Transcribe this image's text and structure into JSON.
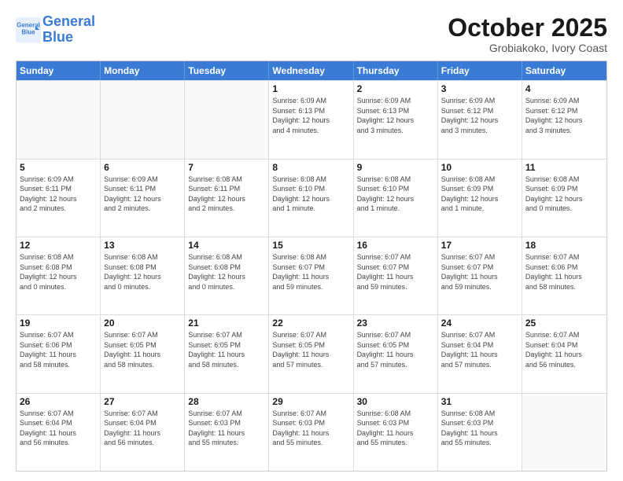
{
  "header": {
    "logo_line1": "General",
    "logo_line2": "Blue",
    "title": "October 2025",
    "subtitle": "Grobiakoko, Ivory Coast"
  },
  "days_of_week": [
    "Sunday",
    "Monday",
    "Tuesday",
    "Wednesday",
    "Thursday",
    "Friday",
    "Saturday"
  ],
  "weeks": [
    [
      {
        "day": "",
        "info": ""
      },
      {
        "day": "",
        "info": ""
      },
      {
        "day": "",
        "info": ""
      },
      {
        "day": "1",
        "info": "Sunrise: 6:09 AM\nSunset: 6:13 PM\nDaylight: 12 hours\nand 4 minutes."
      },
      {
        "day": "2",
        "info": "Sunrise: 6:09 AM\nSunset: 6:13 PM\nDaylight: 12 hours\nand 3 minutes."
      },
      {
        "day": "3",
        "info": "Sunrise: 6:09 AM\nSunset: 6:12 PM\nDaylight: 12 hours\nand 3 minutes."
      },
      {
        "day": "4",
        "info": "Sunrise: 6:09 AM\nSunset: 6:12 PM\nDaylight: 12 hours\nand 3 minutes."
      }
    ],
    [
      {
        "day": "5",
        "info": "Sunrise: 6:09 AM\nSunset: 6:11 PM\nDaylight: 12 hours\nand 2 minutes."
      },
      {
        "day": "6",
        "info": "Sunrise: 6:09 AM\nSunset: 6:11 PM\nDaylight: 12 hours\nand 2 minutes."
      },
      {
        "day": "7",
        "info": "Sunrise: 6:08 AM\nSunset: 6:11 PM\nDaylight: 12 hours\nand 2 minutes."
      },
      {
        "day": "8",
        "info": "Sunrise: 6:08 AM\nSunset: 6:10 PM\nDaylight: 12 hours\nand 1 minute."
      },
      {
        "day": "9",
        "info": "Sunrise: 6:08 AM\nSunset: 6:10 PM\nDaylight: 12 hours\nand 1 minute."
      },
      {
        "day": "10",
        "info": "Sunrise: 6:08 AM\nSunset: 6:09 PM\nDaylight: 12 hours\nand 1 minute."
      },
      {
        "day": "11",
        "info": "Sunrise: 6:08 AM\nSunset: 6:09 PM\nDaylight: 12 hours\nand 0 minutes."
      }
    ],
    [
      {
        "day": "12",
        "info": "Sunrise: 6:08 AM\nSunset: 6:08 PM\nDaylight: 12 hours\nand 0 minutes."
      },
      {
        "day": "13",
        "info": "Sunrise: 6:08 AM\nSunset: 6:08 PM\nDaylight: 12 hours\nand 0 minutes."
      },
      {
        "day": "14",
        "info": "Sunrise: 6:08 AM\nSunset: 6:08 PM\nDaylight: 12 hours\nand 0 minutes."
      },
      {
        "day": "15",
        "info": "Sunrise: 6:08 AM\nSunset: 6:07 PM\nDaylight: 11 hours\nand 59 minutes."
      },
      {
        "day": "16",
        "info": "Sunrise: 6:07 AM\nSunset: 6:07 PM\nDaylight: 11 hours\nand 59 minutes."
      },
      {
        "day": "17",
        "info": "Sunrise: 6:07 AM\nSunset: 6:07 PM\nDaylight: 11 hours\nand 59 minutes."
      },
      {
        "day": "18",
        "info": "Sunrise: 6:07 AM\nSunset: 6:06 PM\nDaylight: 11 hours\nand 58 minutes."
      }
    ],
    [
      {
        "day": "19",
        "info": "Sunrise: 6:07 AM\nSunset: 6:06 PM\nDaylight: 11 hours\nand 58 minutes."
      },
      {
        "day": "20",
        "info": "Sunrise: 6:07 AM\nSunset: 6:05 PM\nDaylight: 11 hours\nand 58 minutes."
      },
      {
        "day": "21",
        "info": "Sunrise: 6:07 AM\nSunset: 6:05 PM\nDaylight: 11 hours\nand 58 minutes."
      },
      {
        "day": "22",
        "info": "Sunrise: 6:07 AM\nSunset: 6:05 PM\nDaylight: 11 hours\nand 57 minutes."
      },
      {
        "day": "23",
        "info": "Sunrise: 6:07 AM\nSunset: 6:05 PM\nDaylight: 11 hours\nand 57 minutes."
      },
      {
        "day": "24",
        "info": "Sunrise: 6:07 AM\nSunset: 6:04 PM\nDaylight: 11 hours\nand 57 minutes."
      },
      {
        "day": "25",
        "info": "Sunrise: 6:07 AM\nSunset: 6:04 PM\nDaylight: 11 hours\nand 56 minutes."
      }
    ],
    [
      {
        "day": "26",
        "info": "Sunrise: 6:07 AM\nSunset: 6:04 PM\nDaylight: 11 hours\nand 56 minutes."
      },
      {
        "day": "27",
        "info": "Sunrise: 6:07 AM\nSunset: 6:04 PM\nDaylight: 11 hours\nand 56 minutes."
      },
      {
        "day": "28",
        "info": "Sunrise: 6:07 AM\nSunset: 6:03 PM\nDaylight: 11 hours\nand 55 minutes."
      },
      {
        "day": "29",
        "info": "Sunrise: 6:07 AM\nSunset: 6:03 PM\nDaylight: 11 hours\nand 55 minutes."
      },
      {
        "day": "30",
        "info": "Sunrise: 6:08 AM\nSunset: 6:03 PM\nDaylight: 11 hours\nand 55 minutes."
      },
      {
        "day": "31",
        "info": "Sunrise: 6:08 AM\nSunset: 6:03 PM\nDaylight: 11 hours\nand 55 minutes."
      },
      {
        "day": "",
        "info": ""
      }
    ]
  ]
}
